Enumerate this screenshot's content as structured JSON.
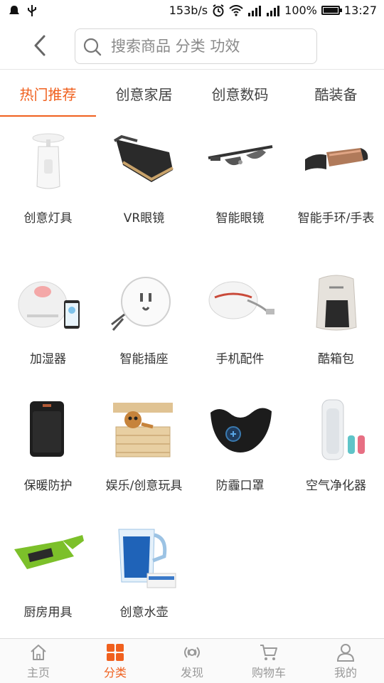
{
  "status_bar": {
    "speed": "153b/s",
    "battery": "100%",
    "battery_level": 1.0,
    "time": "13:27"
  },
  "search": {
    "placeholder": "搜索商品 分类 功效"
  },
  "tabs": [
    {
      "label": "热门推荐",
      "active": true
    },
    {
      "label": "创意家居",
      "active": false
    },
    {
      "label": "创意数码",
      "active": false
    },
    {
      "label": "酷装备",
      "active": false
    }
  ],
  "categories": [
    {
      "label": "创意灯具",
      "icon": "lamp-icon"
    },
    {
      "label": "VR眼镜",
      "icon": "vr-glasses-icon"
    },
    {
      "label": "智能眼镜",
      "icon": "smart-glasses-icon"
    },
    {
      "label": "智能手环/手表",
      "icon": "smart-band-icon"
    },
    {
      "label": "加湿器",
      "icon": "humidifier-icon"
    },
    {
      "label": "智能插座",
      "icon": "smart-socket-icon"
    },
    {
      "label": "手机配件",
      "icon": "phone-accessory-icon"
    },
    {
      "label": "酷箱包",
      "icon": "backpack-icon"
    },
    {
      "label": "保暖防护",
      "icon": "heater-icon"
    },
    {
      "label": "娱乐/创意玩具",
      "icon": "toy-box-icon"
    },
    {
      "label": "防霾口罩",
      "icon": "mask-icon"
    },
    {
      "label": "空气净化器",
      "icon": "air-purifier-icon"
    },
    {
      "label": "厨房用具",
      "icon": "cutting-board-icon"
    },
    {
      "label": "创意水壶",
      "icon": "water-pitcher-icon"
    }
  ],
  "bottom_nav": [
    {
      "label": "主页",
      "icon": "home-icon",
      "active": false
    },
    {
      "label": "分类",
      "icon": "category-grid-icon",
      "active": true
    },
    {
      "label": "发现",
      "icon": "discover-icon",
      "active": false
    },
    {
      "label": "购物车",
      "icon": "cart-icon",
      "active": false
    },
    {
      "label": "我的",
      "icon": "user-icon",
      "active": false
    }
  ],
  "colors": {
    "accent": "#f0601e",
    "inactive": "#999999"
  }
}
